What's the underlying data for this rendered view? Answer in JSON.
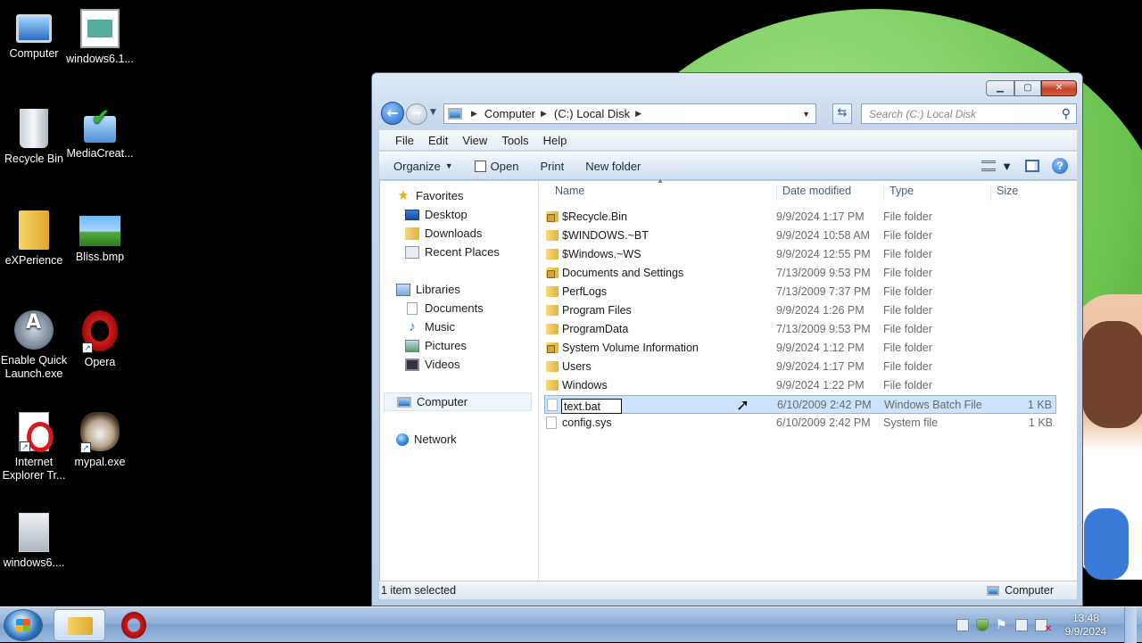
{
  "desktop": {
    "icons": [
      {
        "label": "Computer",
        "icon": "computer-icon"
      },
      {
        "label": "windows6.1...",
        "icon": "document-icon"
      },
      {
        "label": "Recycle Bin",
        "icon": "recycle-bin-icon"
      },
      {
        "label": "MediaCreat...",
        "icon": "media-creation-icon"
      },
      {
        "label": "eXPerience",
        "icon": "folder-icon"
      },
      {
        "label": "Bliss.bmp",
        "icon": "bitmap-icon"
      },
      {
        "label": "Enable Quick Launch.exe",
        "icon": "quick-launch-icon"
      },
      {
        "label": "Opera",
        "icon": "opera-icon"
      },
      {
        "label": "Internet Explorer Tr...",
        "icon": "opera-document-icon"
      },
      {
        "label": "mypal.exe",
        "icon": "mypal-icon"
      },
      {
        "label": "windows6....",
        "icon": "installer-icon"
      }
    ]
  },
  "window": {
    "address": {
      "segments": [
        "Computer",
        "(C:) Local Disk"
      ]
    },
    "search_placeholder": "Search (C:) Local Disk",
    "menu": [
      "File",
      "Edit",
      "View",
      "Tools",
      "Help"
    ],
    "toolbar": {
      "organize": "Organize",
      "open": "Open",
      "print": "Print",
      "new_folder": "New folder"
    },
    "nav": {
      "favorites": "Favorites",
      "desktop": "Desktop",
      "downloads": "Downloads",
      "recent_places": "Recent Places",
      "libraries": "Libraries",
      "documents": "Documents",
      "music": "Music",
      "pictures": "Pictures",
      "videos": "Videos",
      "computer": "Computer",
      "network": "Network"
    },
    "columns": {
      "name": "Name",
      "date": "Date modified",
      "type": "Type",
      "size": "Size"
    },
    "files": [
      {
        "name": "$Recycle.Bin",
        "date": "9/9/2024 1:17 PM",
        "type": "File folder",
        "size": ""
      },
      {
        "name": "$WINDOWS.~BT",
        "date": "9/9/2024 10:58 AM",
        "type": "File folder",
        "size": ""
      },
      {
        "name": "$Windows.~WS",
        "date": "9/9/2024 12:55 PM",
        "type": "File folder",
        "size": ""
      },
      {
        "name": "Documents and Settings",
        "date": "7/13/2009 9:53 PM",
        "type": "File folder",
        "size": ""
      },
      {
        "name": "PerfLogs",
        "date": "7/13/2009 7:37 PM",
        "type": "File folder",
        "size": ""
      },
      {
        "name": "Program Files",
        "date": "9/9/2024 1:26 PM",
        "type": "File folder",
        "size": ""
      },
      {
        "name": "ProgramData",
        "date": "7/13/2009 9:53 PM",
        "type": "File folder",
        "size": ""
      },
      {
        "name": "System Volume Information",
        "date": "9/9/2024 1:12 PM",
        "type": "File folder",
        "size": ""
      },
      {
        "name": "Users",
        "date": "9/9/2024 1:17 PM",
        "type": "File folder",
        "size": ""
      },
      {
        "name": "Windows",
        "date": "9/9/2024 1:22 PM",
        "type": "File folder",
        "size": ""
      },
      {
        "name": "text.bat",
        "date": "6/10/2009 2:42 PM",
        "type": "Windows Batch File",
        "size": "1 KB"
      },
      {
        "name": "config.sys",
        "date": "6/10/2009 2:42 PM",
        "type": "System file",
        "size": "1 KB"
      }
    ],
    "rename_value": "text.bat",
    "status": {
      "selected": "1 item selected",
      "location": "Computer"
    }
  },
  "taskbar": {
    "time": "13:48",
    "date": "9/9/2024"
  }
}
